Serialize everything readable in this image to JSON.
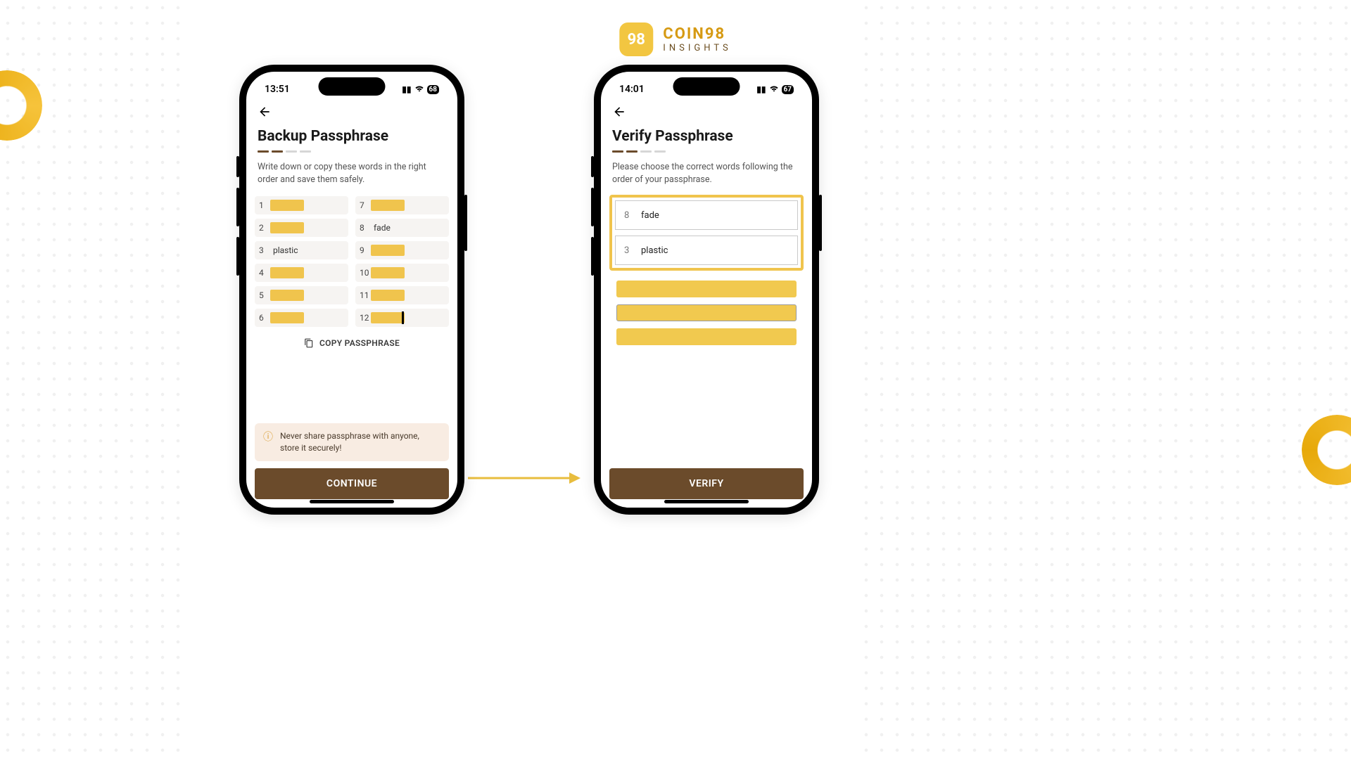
{
  "brand": {
    "mark": "98",
    "name": "COIN98",
    "sub": "INSIGHTS"
  },
  "colors": {
    "accent": "#f0c44d",
    "primary_button": "#6b4b2b"
  },
  "phone1": {
    "status": {
      "time": "13:51",
      "battery": "68"
    },
    "title": "Backup Passphrase",
    "subtitle": "Write down or copy these words in the right order and save them safely.",
    "words": [
      {
        "n": "1",
        "word": "",
        "hidden": true
      },
      {
        "n": "7",
        "word": "",
        "hidden": true
      },
      {
        "n": "2",
        "word": "",
        "hidden": true
      },
      {
        "n": "8",
        "word": "fade",
        "hidden": false
      },
      {
        "n": "3",
        "word": "plastic",
        "hidden": false
      },
      {
        "n": "9",
        "word": "",
        "hidden": true
      },
      {
        "n": "4",
        "word": "",
        "hidden": true
      },
      {
        "n": "10",
        "word": "",
        "hidden": true
      },
      {
        "n": "5",
        "word": "",
        "hidden": true
      },
      {
        "n": "11",
        "word": "",
        "hidden": true
      },
      {
        "n": "6",
        "word": "",
        "hidden": true
      },
      {
        "n": "12",
        "word": "",
        "hidden": true,
        "cursor": true
      }
    ],
    "copy_label": "COPY PASSPHRASE",
    "warning": "Never share passphrase with anyone, store it securely!",
    "cta": "CONTINUE"
  },
  "phone2": {
    "status": {
      "time": "14:01",
      "battery": "67"
    },
    "title": "Verify Passphrase",
    "subtitle": "Please choose the correct words following the order of your passphrase.",
    "verify_items": [
      {
        "n": "8",
        "word": "fade"
      },
      {
        "n": "3",
        "word": "plastic"
      }
    ],
    "cta": "VERIFY"
  }
}
